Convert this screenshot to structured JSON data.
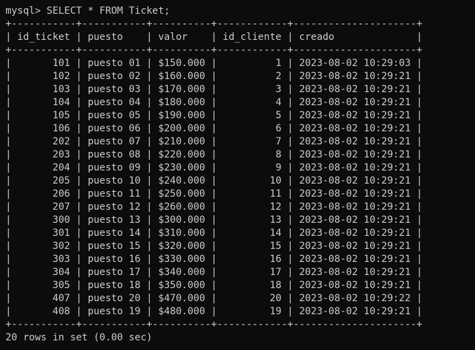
{
  "terminal": {
    "prompt": "mysql> ",
    "command": "SELECT * FROM Ticket;",
    "border_line": "+-----------+-----------+----------+------------+---------------------+",
    "header_line": "| id_ticket | puesto    | valor    | id_cliente | creado              |",
    "rows": [
      "|       101 | puesto 01 | $150.000 |          1 | 2023-08-02 10:29:03 |",
      "|       102 | puesto 02 | $160.000 |          2 | 2023-08-02 10:29:21 |",
      "|       103 | puesto 03 | $170.000 |          3 | 2023-08-02 10:29:21 |",
      "|       104 | puesto 04 | $180.000 |          4 | 2023-08-02 10:29:21 |",
      "|       105 | puesto 05 | $190.000 |          5 | 2023-08-02 10:29:21 |",
      "|       106 | puesto 06 | $200.000 |          6 | 2023-08-02 10:29:21 |",
      "|       202 | puesto 07 | $210.000 |          7 | 2023-08-02 10:29:21 |",
      "|       203 | puesto 08 | $220.000 |          8 | 2023-08-02 10:29:21 |",
      "|       204 | puesto 09 | $230.000 |          9 | 2023-08-02 10:29:21 |",
      "|       205 | puesto 10 | $240.000 |         10 | 2023-08-02 10:29:21 |",
      "|       206 | puesto 11 | $250.000 |         11 | 2023-08-02 10:29:21 |",
      "|       207 | puesto 12 | $260.000 |         12 | 2023-08-02 10:29:21 |",
      "|       300 | puesto 13 | $300.000 |         13 | 2023-08-02 10:29:21 |",
      "|       301 | puesto 14 | $310.000 |         14 | 2023-08-02 10:29:21 |",
      "|       302 | puesto 15 | $320.000 |         15 | 2023-08-02 10:29:21 |",
      "|       303 | puesto 16 | $330.000 |         16 | 2023-08-02 10:29:21 |",
      "|       304 | puesto 17 | $340.000 |         17 | 2023-08-02 10:29:21 |",
      "|       305 | puesto 18 | $350.000 |         18 | 2023-08-02 10:29:21 |",
      "|       407 | puesto 20 | $470.000 |         20 | 2023-08-02 10:29:22 |",
      "|       408 | puesto 19 | $480.000 |         19 | 2023-08-02 10:29:21 |"
    ],
    "footer": "20 rows in set (0.00 sec)",
    "colors": {
      "background": "#0c0c0c",
      "text": "#cccccc"
    }
  }
}
